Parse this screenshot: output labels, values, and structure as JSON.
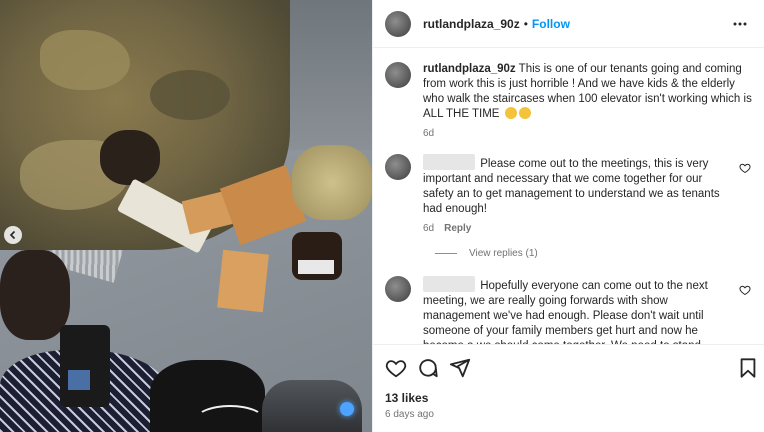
{
  "post": {
    "username": "rutlandplaza_90z",
    "follow_label": "Follow",
    "separator": "•"
  },
  "caption": {
    "username": "rutlandplaza_90z",
    "text": "This is one of our tenants going and coming from work this is just horrible ! And we have kids & the elderly who walk the staircases when 100 elevator isn't working which is ALL THE TIME",
    "emojis": [
      "grimacing-face",
      "unamused-face"
    ],
    "time": "6d"
  },
  "comments": [
    {
      "text": "Please come out to the meetings, this is very important and necessary that we come together for our safety an to get management to understand we as tenants had enough!",
      "time": "6d",
      "reply_label": "Reply",
      "view_replies_label": "View replies (1)"
    },
    {
      "text": "Hopefully everyone can come out to the next meeting, we are really going forwards with show management we've had enough. Please don't wait until someone of your family members get hurt and now he become a we should come together. We need to stand together in unity now folks"
    }
  ],
  "footer": {
    "likes": "13 likes",
    "posted": "6 days ago"
  },
  "icons": {
    "more": "more-horizontal-icon",
    "like": "heart-icon",
    "comment": "comment-icon",
    "share": "share-icon",
    "save": "bookmark-icon",
    "carousel_prev": "chevron-left-icon"
  },
  "colors": {
    "accent": "#0095f6",
    "text": "#262626",
    "muted": "#737373"
  }
}
